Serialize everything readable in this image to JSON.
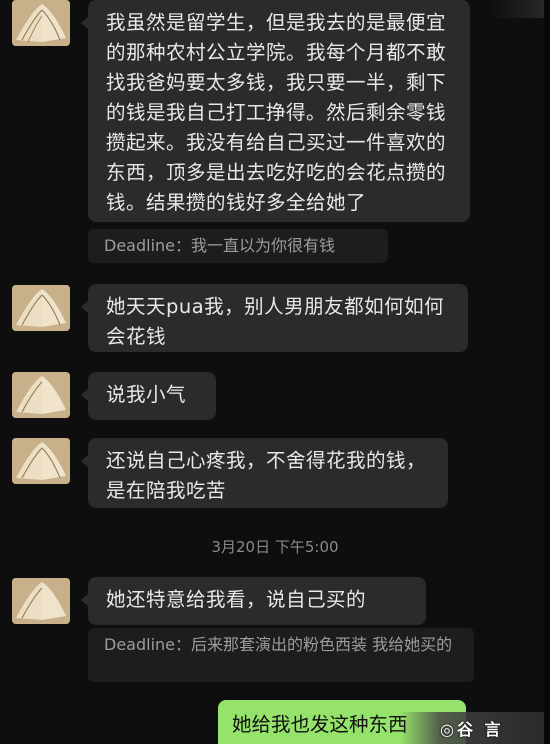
{
  "messages": [
    {
      "text": "我虽然是留学生，但是我去的是最便宜的那种农村公立学院。我每个月都不敢找我爸妈要太多钱，我只要一半，剩下的钱是我自己打工挣得。然后剩余零钱攒起来。我没有给自己买过一件喜欢的东西，顶多是出去吃好吃的会花点攒的钱。结果攒的钱好多全给她了"
    },
    {
      "quote": "Deadline：我一直以为你很有钱"
    },
    {
      "text": "她天天pua我，别人男朋友都如何如何会花钱"
    },
    {
      "text": "说我小气"
    },
    {
      "text": "还说自己心疼我，不舍得花我的钱，是在陪我吃苦"
    },
    {
      "text": "她还特意给我看，说自己买的"
    },
    {
      "quote": "Deadline：后来那套演出的粉色西装 我给她买的"
    },
    {
      "text": "她给我也发这种东西"
    }
  ],
  "timestamp": "3月20日 下午5:00",
  "watermark_text": "◎谷 言"
}
